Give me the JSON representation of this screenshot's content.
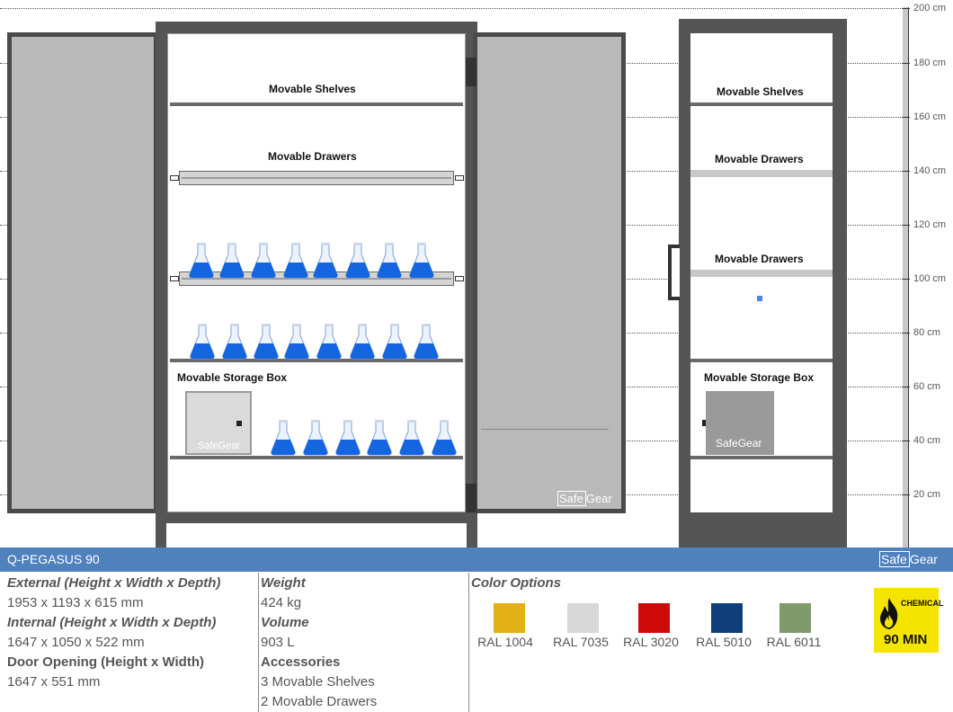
{
  "ruler": {
    "labels": [
      "200 cm",
      "180 cm",
      "160 cm",
      "140 cm",
      "120 cm",
      "100 cm",
      "80 cm",
      "60 cm",
      "40 cm",
      "20 cm"
    ]
  },
  "front_view": {
    "labels": {
      "shelves": "Movable Shelves",
      "drawers": "Movable Drawers",
      "storage_box": "Movable Storage Box"
    },
    "box_logo": {
      "safe": "Safe",
      "gear": "Gear"
    },
    "door_logo": {
      "safe": "Safe",
      "gear": "Gear"
    }
  },
  "side_view": {
    "labels": {
      "shelves": "Movable Shelves",
      "drawers_1": "Movable Drawers",
      "drawers_2": "Movable Drawers",
      "storage_box": "Movable Storage Box"
    },
    "box_logo": {
      "safe": "Safe",
      "gear": "Gear"
    }
  },
  "product_bar": {
    "title": "Q-PEGASUS 90",
    "logo": {
      "safe": "Safe",
      "gear": "Gear"
    },
    "color": "#4f81bd"
  },
  "specs": {
    "external_label": "External (Height x Width x Depth)",
    "external_value": "1953 x 1193 x 615 mm",
    "internal_label": "Internal (Height x Width x Depth)",
    "internal_value": "1647 x 1050 x 522 mm",
    "door_label": "Door Opening (Height x Width)",
    "door_value": "1647 x 551 mm",
    "weight_label": "Weight",
    "weight_value": "424 kg",
    "volume_label": "Volume",
    "volume_value": "903 L",
    "accessories_label": "Accessories",
    "accessories": [
      "3 Movable Shelves",
      "2 Movable Drawers"
    ]
  },
  "colors": {
    "title": "Color Options",
    "options": [
      {
        "name": "RAL 1004",
        "hex": "#e0b015"
      },
      {
        "name": "RAL 7035",
        "hex": "#d7d7d7"
      },
      {
        "name": "RAL 3020",
        "hex": "#cc0a0a"
      },
      {
        "name": "RAL 5010",
        "hex": "#0e3f7a"
      },
      {
        "name": "RAL 6011",
        "hex": "#7f9a6b"
      }
    ]
  },
  "badge": {
    "top": "CHEMICAL",
    "bottom": "90 MIN",
    "icon": "flame-icon",
    "color": "#f5e400"
  },
  "flask_color": "#1565e0"
}
